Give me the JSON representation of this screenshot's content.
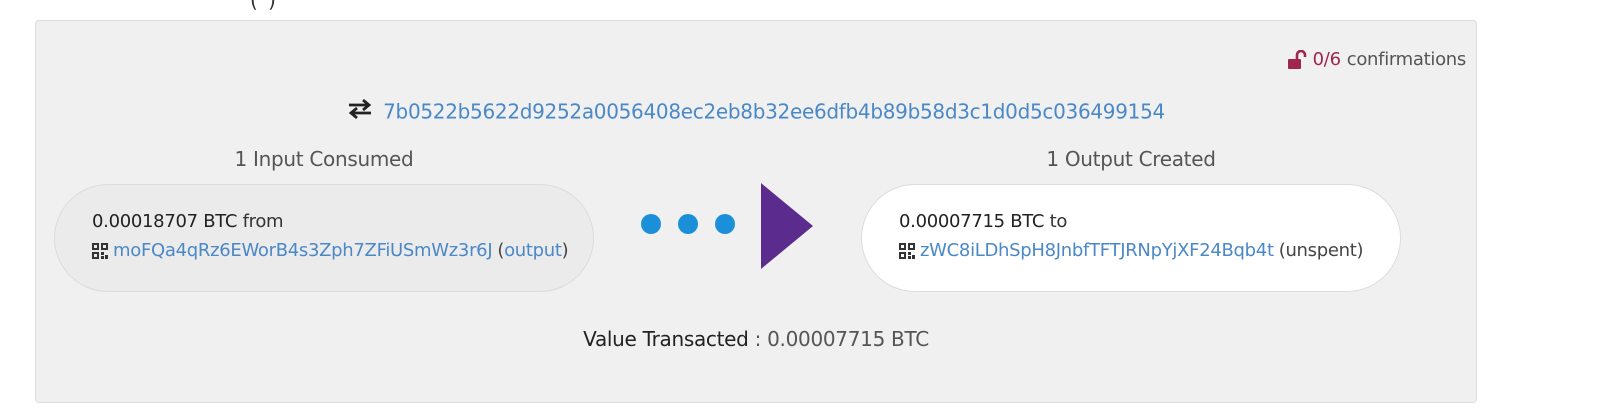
{
  "top_fragment": "(                                        )",
  "confirmations": {
    "count": "0/6",
    "label": "confirmations",
    "lock_color": "#a0264d"
  },
  "transaction": {
    "txid": "7b0522b5622d9252a0056408ec2eb8b32ee6dfb4b89b58d3c1d0d5c036499154",
    "swap_icon": "swap-arrows-icon"
  },
  "inputs": {
    "heading": "1 Input Consumed",
    "items": [
      {
        "amount": "0.00018707 BTC",
        "preposition": "from",
        "address": "moFQa4qRz6EWorB4s3Zph7ZFiUSmWz3r6J",
        "link_label": "output",
        "icon": "qr-code-icon"
      }
    ]
  },
  "outputs": {
    "heading": "1 Output Created",
    "items": [
      {
        "amount": "0.00007715 BTC",
        "preposition": "to",
        "address": "zWC8iLDhSpH8JnbfTFTJRNpYjXF24Bqb4t",
        "status": "unspent",
        "icon": "qr-code-icon"
      }
    ]
  },
  "flow": {
    "dot_color": "#1b8fd9",
    "arrow_color": "#5b2c8d",
    "dots": 3
  },
  "summary": {
    "label": "Value Transacted",
    "separator": " : ",
    "value": "0.00007715 BTC"
  },
  "colors": {
    "link": "#4a88c7",
    "panel_bg": "#f0f0f0"
  }
}
